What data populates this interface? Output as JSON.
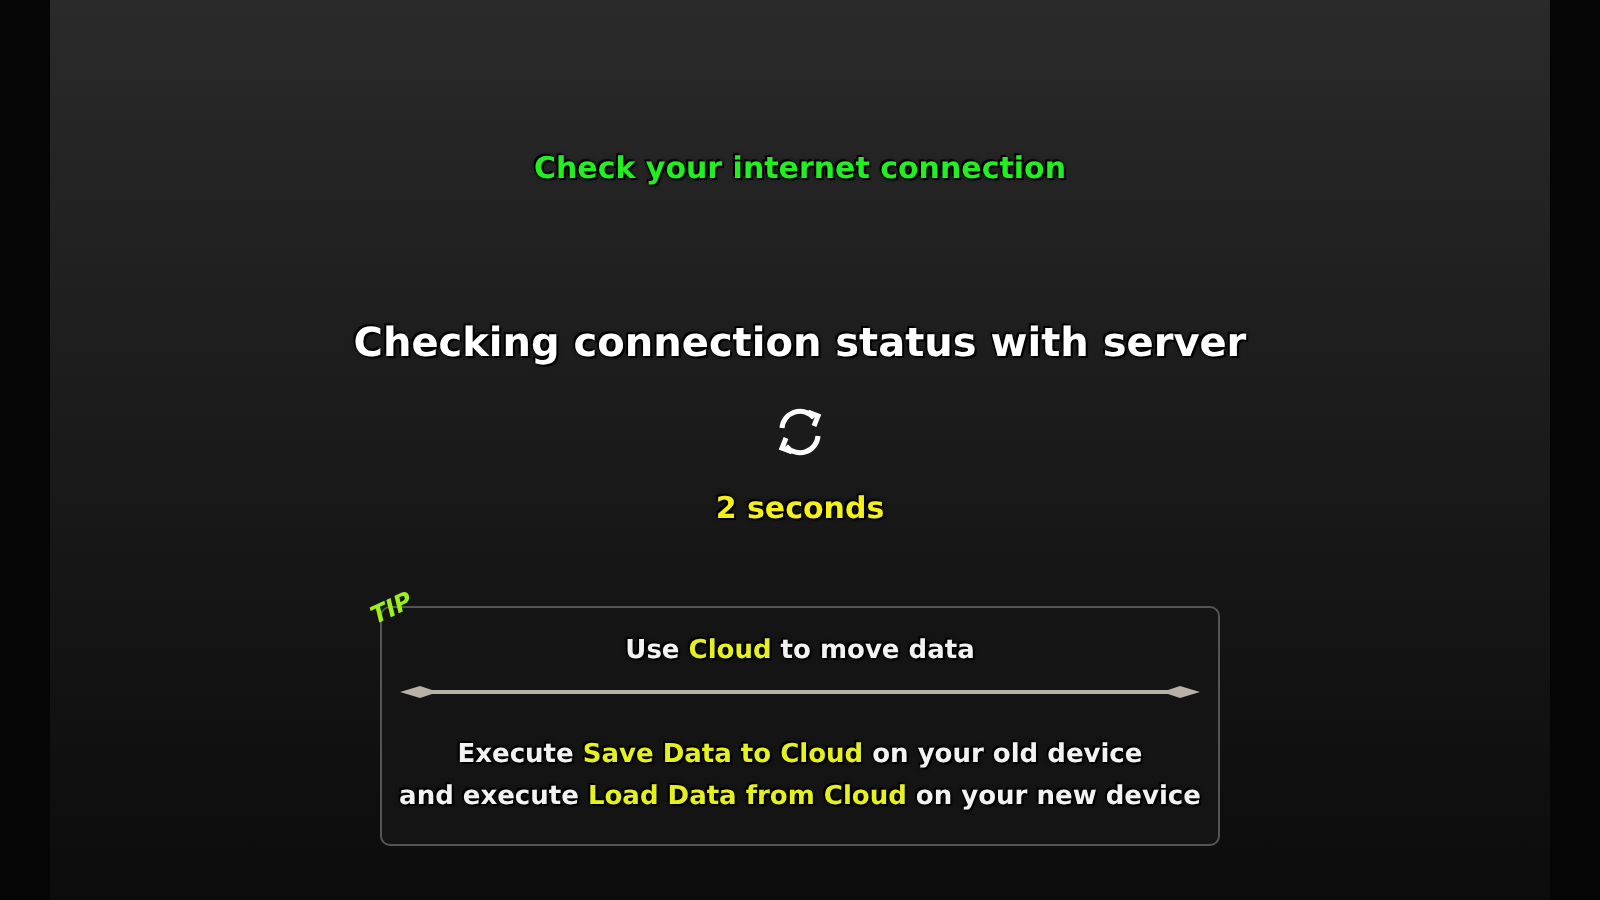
{
  "warning": "Check your internet connection",
  "status": "Checking connection status with server",
  "countdown": "2 seconds",
  "tip": {
    "badge": "TIP",
    "title": [
      {
        "text": "Use ",
        "highlight": false
      },
      {
        "text": "Cloud",
        "highlight": true
      },
      {
        "text": " to move data",
        "highlight": false
      }
    ],
    "lines": [
      [
        {
          "text": "Execute ",
          "highlight": false
        },
        {
          "text": "Save Data to Cloud",
          "highlight": true
        },
        {
          "text": " on your old device",
          "highlight": false
        }
      ],
      [
        {
          "text": "and execute ",
          "highlight": false
        },
        {
          "text": "Load Data from Cloud",
          "highlight": true
        },
        {
          "text": " on your new device",
          "highlight": false
        }
      ]
    ]
  }
}
